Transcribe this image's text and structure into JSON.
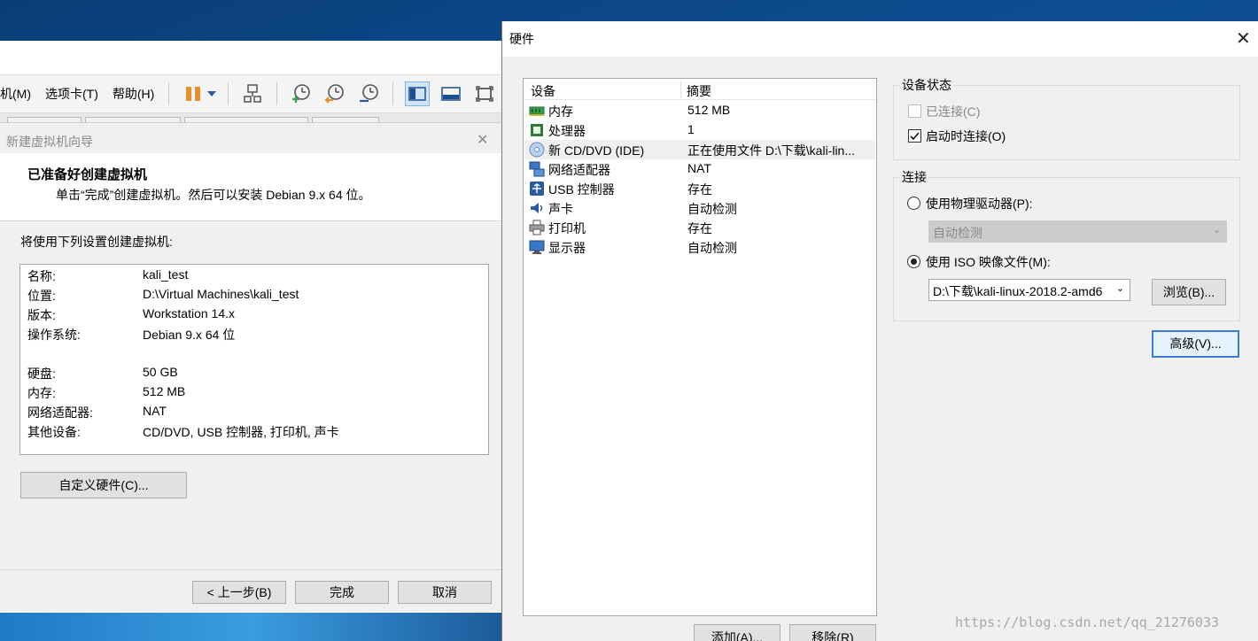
{
  "vmware": {
    "menu": [
      "机(M)",
      "选项卡(T)",
      "帮助(H)"
    ],
    "toolbar_icons": [
      "pause-icon",
      "dropdown-icon",
      "network-icon",
      "snapshot-take-icon",
      "snapshot-revert-icon",
      "snapshot-manager-icon",
      "sidebar-view-icon",
      "console-view-icon",
      "fullscreen-icon"
    ]
  },
  "wizard": {
    "title": "新建虚拟机向导",
    "heading": "已准备好创建虚拟机",
    "subheading": "单击“完成”创建虚拟机。然后可以安装 Debian 9.x 64 位。",
    "intro": "将使用下列设置创建虚拟机:",
    "summary": [
      {
        "key": "名称:",
        "value": "kali_test"
      },
      {
        "key": "位置:",
        "value": "D:\\Virtual Machines\\kali_test"
      },
      {
        "key": "版本:",
        "value": "Workstation 14.x"
      },
      {
        "key": "操作系统:",
        "value": "Debian 9.x 64 位"
      },
      {
        "key": "硬盘:",
        "value": "50 GB"
      },
      {
        "key": "内存:",
        "value": "512 MB"
      },
      {
        "key": "网络适配器:",
        "value": "NAT"
      },
      {
        "key": "其他设备:",
        "value": "CD/DVD, USB 控制器, 打印机, 声卡"
      }
    ],
    "customize_label": "自定义硬件(C)...",
    "back_label": "< 上一步(B)",
    "finish_label": "完成",
    "cancel_label": "取消"
  },
  "hardware": {
    "title": "硬件",
    "columns": [
      "设备",
      "摘要"
    ],
    "devices": [
      {
        "name": "内存",
        "summary": "512 MB",
        "icon": "memory-icon"
      },
      {
        "name": "处理器",
        "summary": "1",
        "icon": "cpu-icon"
      },
      {
        "name": "新 CD/DVD (IDE)",
        "summary": "正在使用文件 D:\\下载\\kali-lin...",
        "icon": "cd-dvd-icon",
        "selected": true
      },
      {
        "name": "网络适配器",
        "summary": "NAT",
        "icon": "network-adapter-icon"
      },
      {
        "name": "USB 控制器",
        "summary": "存在",
        "icon": "usb-icon"
      },
      {
        "name": "声卡",
        "summary": "自动检测",
        "icon": "sound-icon"
      },
      {
        "name": "打印机",
        "summary": "存在",
        "icon": "printer-icon"
      },
      {
        "name": "显示器",
        "summary": "自动检测",
        "icon": "display-icon"
      }
    ],
    "add_label": "添加(A)...",
    "remove_label": "移除(R)",
    "device_status": {
      "title": "设备状态",
      "connected_label": "已连接(C)",
      "connected_checked": false,
      "connected_enabled": false,
      "connect_at_power_on_label": "启动时连接(O)",
      "connect_at_power_on_checked": true
    },
    "connection": {
      "title": "连接",
      "physical_drive_label": "使用物理驱动器(P):",
      "physical_drive_value": "自动检测",
      "iso_label": "使用 ISO 映像文件(M):",
      "iso_path": "D:\\下载\\kali-linux-2018.2-amd6",
      "browse_label": "浏览(B)...",
      "selected": "iso"
    },
    "advanced_label": "高级(V)..."
  },
  "watermark": "https://blog.csdn.net/qq_21276033",
  "colors": {
    "accent": "#3a7bd5",
    "pause": "#e8912c",
    "desktop": "#0d4f93"
  }
}
